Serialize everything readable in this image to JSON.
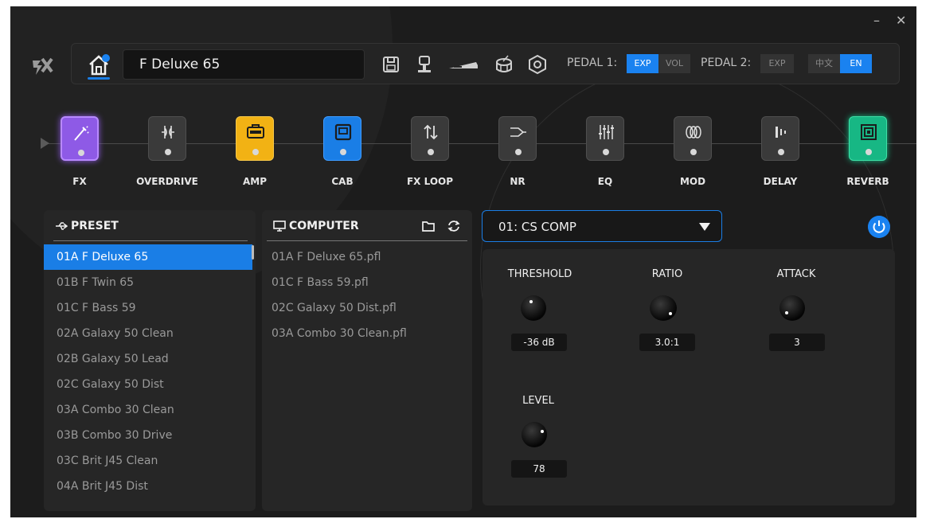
{
  "window": {
    "minimize_glyph": "–",
    "close_glyph": "✕"
  },
  "topbar": {
    "preset_name": "F Deluxe 65",
    "pedal1_label": "PEDAL 1:",
    "pedal1_exp": "EXP",
    "pedal1_vol": "VOL",
    "pedal2_label": "PEDAL 2:",
    "pedal2_exp": "EXP",
    "lang_zh": "中文",
    "lang_en": "EN",
    "icons": [
      "home-icon",
      "save-icon",
      "tuner-icon",
      "guitar-cable-icon",
      "drum-icon",
      "settings-icon"
    ]
  },
  "chain": {
    "blocks": [
      {
        "label": "FX",
        "color": "#8e5ae6",
        "active": true
      },
      {
        "label": "OVERDRIVE",
        "active": false
      },
      {
        "label": "AMP",
        "color": "#f2b214",
        "active": true
      },
      {
        "label": "CAB",
        "color": "#1a7ee6",
        "active": true
      },
      {
        "label": "FX LOOP",
        "active": false
      },
      {
        "label": "NR",
        "active": false
      },
      {
        "label": "EQ",
        "active": false
      },
      {
        "label": "MOD",
        "active": false
      },
      {
        "label": "DELAY",
        "active": false
      },
      {
        "label": "REVERB",
        "color": "#17b784",
        "active": true
      }
    ]
  },
  "preset_panel": {
    "title": "PRESET",
    "items": [
      "01A F Deluxe 65",
      "01B F Twin 65",
      "01C F Bass 59",
      "02A Galaxy 50 Clean",
      "02B Galaxy 50 Lead",
      "02C Galaxy 50 Dist",
      "03A Combo 30 Clean",
      "03B Combo 30 Drive",
      "03C Brit J45 Clean",
      "04A Brit J45 Dist"
    ],
    "selected_index": 0
  },
  "computer_panel": {
    "title": "COMPUTER",
    "items": [
      "01A F Deluxe 65.pfl",
      "01C F Bass 59.pfl",
      "02C Galaxy 50 Dist.pfl",
      "03A Combo 30 Clean.pfl"
    ]
  },
  "effect": {
    "selected": "01: CS COMP",
    "power_on": true,
    "params": [
      {
        "label": "THRESHOLD",
        "value": "-36 dB"
      },
      {
        "label": "RATIO",
        "value": "3.0:1"
      },
      {
        "label": "ATTACK",
        "value": "3"
      },
      {
        "label": "LEVEL",
        "value": "78"
      }
    ]
  },
  "colors": {
    "accent": "#1a7ee6",
    "background": "#1c1c1c",
    "panel": "#262626"
  }
}
